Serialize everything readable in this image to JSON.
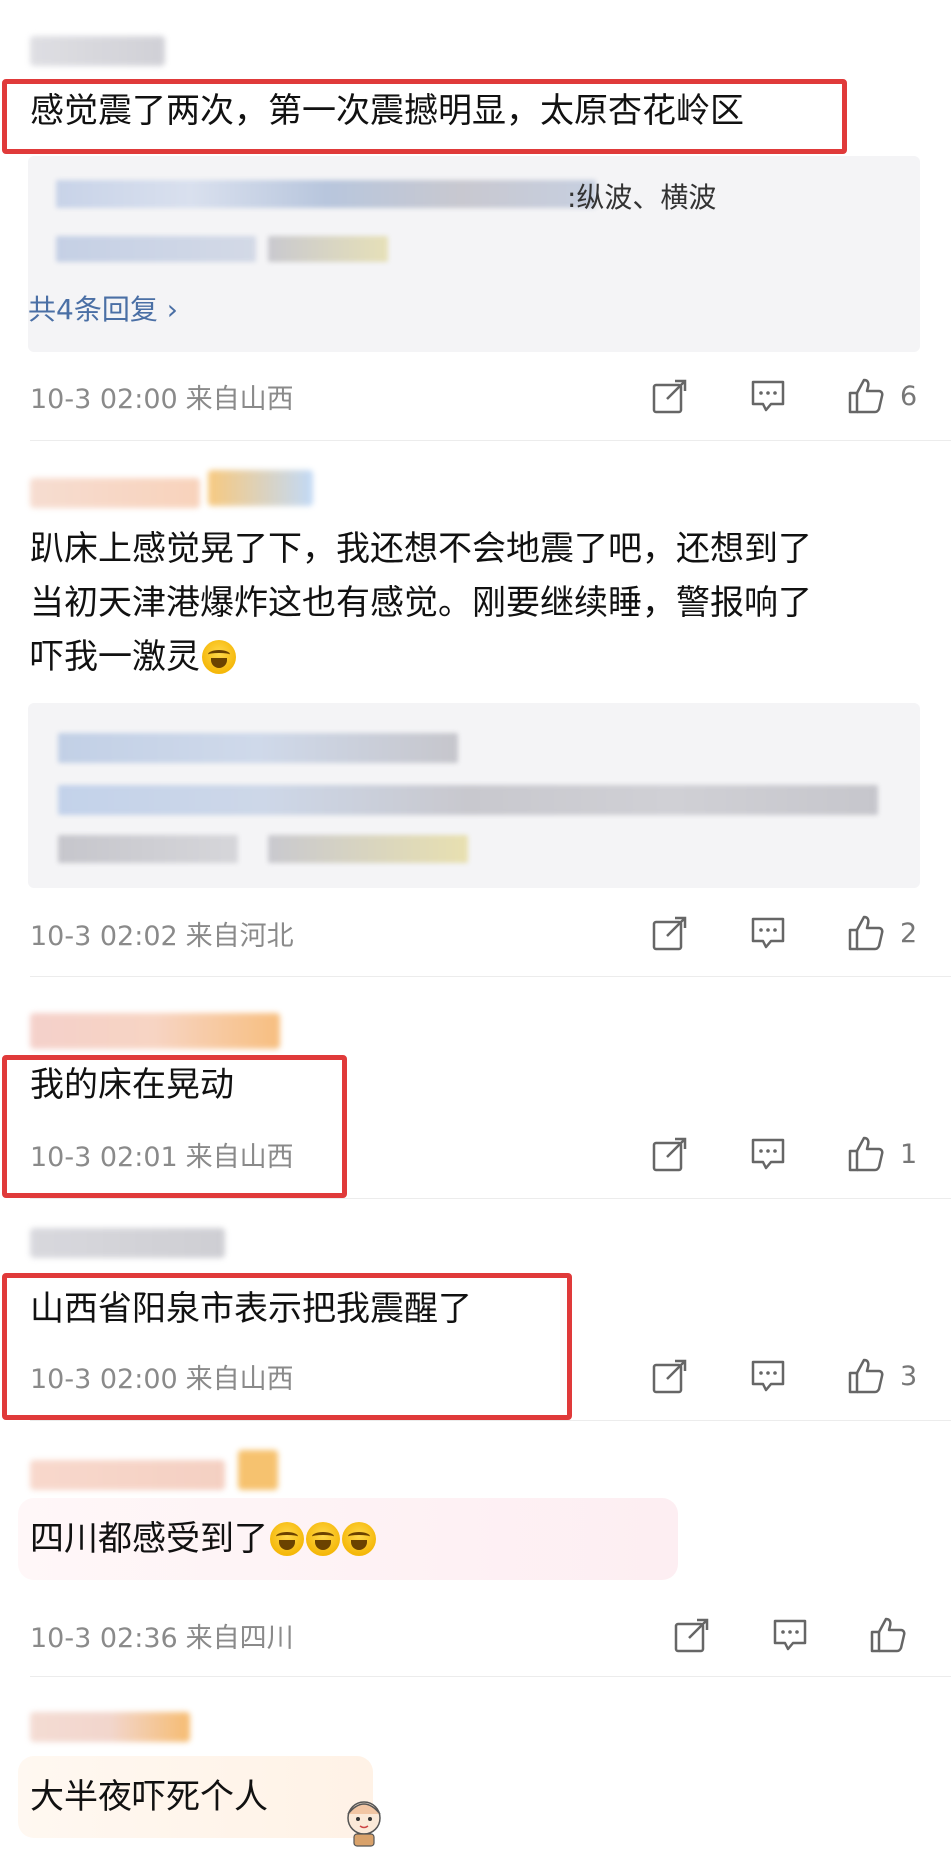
{
  "comments": [
    {
      "text": "感觉震了两次，第一次震撼明显，太原杏花岭区",
      "reply_tail": ":纵波、横波",
      "reply_more": "共4条回复 ›",
      "time": "10-3 02:00",
      "location": "来自山西",
      "likes": "6"
    },
    {
      "text_line1": "趴床上感觉晃了下，我还想不会地震了吧，还想到了",
      "text_line2": "当初天津港爆炸这也有感觉。刚要继续睡，警报响了",
      "text_line3": "吓我一激灵",
      "time": "10-3 02:02",
      "location": "来自河北",
      "likes": "2"
    },
    {
      "text": "我的床在晃动",
      "time": "10-3 02:01",
      "location": "来自山西",
      "likes": "1"
    },
    {
      "text": "山西省阳泉市表示把我震醒了",
      "time": "10-3 02:00",
      "location": "来自山西",
      "likes": "3"
    },
    {
      "text": "四川都感受到了",
      "time": "10-3 02:36",
      "location": "来自四川",
      "likes": ""
    },
    {
      "text": "大半夜吓死个人"
    }
  ],
  "icons": {
    "share": "share-icon",
    "comment": "comment-icon",
    "like": "thumbs-up-icon",
    "emoji": "crying-laughing-emoji"
  },
  "colors": {
    "highlight": "#e03a3a",
    "link": "#4a6fa5",
    "meta": "#8a8a8a"
  }
}
